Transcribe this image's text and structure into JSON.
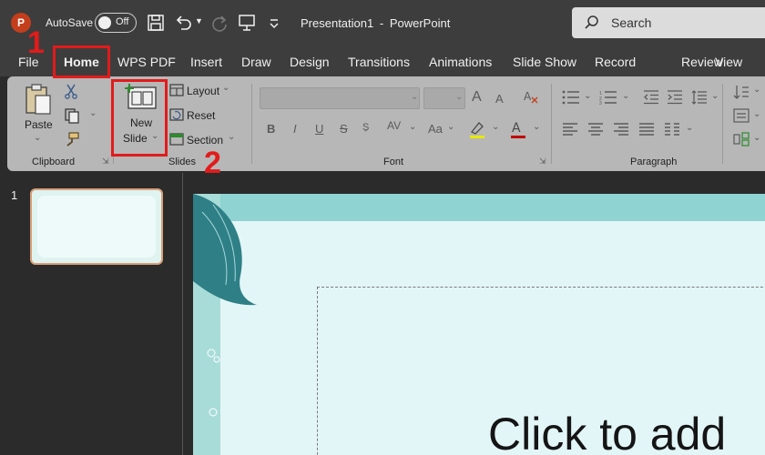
{
  "titlebar": {
    "app_logo": "P",
    "autosave_label": "AutoSave",
    "autosave_state": "Off",
    "document_title": "Presentation1",
    "separator": "-",
    "app_name": "PowerPoint",
    "search_placeholder": "Search",
    "icons": [
      "powerpoint-logo-icon",
      "save-icon",
      "undo-icon",
      "redo-icon",
      "present-icon",
      "customize-qat-icon",
      "search-icon"
    ]
  },
  "tabs": [
    {
      "label": "File",
      "active": false
    },
    {
      "label": "Home",
      "active": true
    },
    {
      "label": "WPS PDF",
      "active": false
    },
    {
      "label": "Insert",
      "active": false
    },
    {
      "label": "Draw",
      "active": false
    },
    {
      "label": "Design",
      "active": false
    },
    {
      "label": "Transitions",
      "active": false
    },
    {
      "label": "Animations",
      "active": false
    },
    {
      "label": "Slide Show",
      "active": false
    },
    {
      "label": "Record",
      "active": false
    },
    {
      "label": "Review",
      "active": false
    },
    {
      "label": "View",
      "active": false
    }
  ],
  "ribbon": {
    "clipboard": {
      "group_label": "Clipboard",
      "paste_label": "Paste"
    },
    "slides": {
      "group_label": "Slides",
      "new_slide_line1": "New",
      "new_slide_line2": "Slide",
      "layout_label": "Layout",
      "reset_label": "Reset",
      "section_label": "Section"
    },
    "font": {
      "group_label": "Font",
      "bold": "B",
      "italic": "I",
      "underline": "U",
      "strikethrough": "S",
      "grow": "A",
      "shrink": "A",
      "char_spacing": "AV",
      "change_case": "Aa",
      "font_color": "A"
    },
    "paragraph": {
      "group_label": "Paragraph"
    }
  },
  "thumbnails": {
    "slide_number": "1"
  },
  "canvas": {
    "title_placeholder": "Click to add"
  },
  "annotations": {
    "step1": "1",
    "step2": "2",
    "accent_color": "#e21b1b"
  },
  "colors": {
    "ribbon": "#b7b7b7",
    "titlebar": "#3d3d3d",
    "canvas": "#e3f6f7"
  }
}
